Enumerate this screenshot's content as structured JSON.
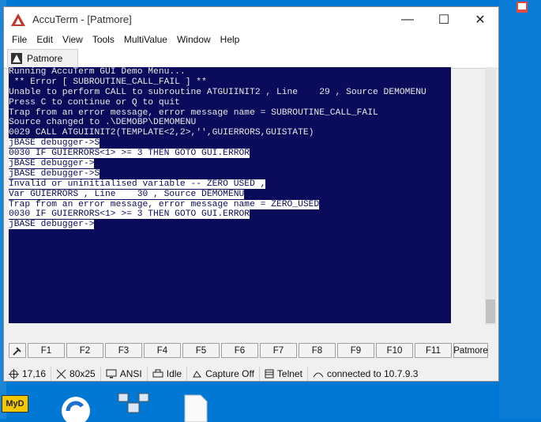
{
  "window": {
    "title": "AccuTerm - [Patmore]",
    "controls": {
      "minimize": "—",
      "maximize": "☐",
      "close": "✕"
    }
  },
  "menu": [
    "File",
    "Edit",
    "View",
    "Tools",
    "MultiValue",
    "Window",
    "Help"
  ],
  "tab": {
    "label": "Patmore"
  },
  "terminal": {
    "background": "#0b0b5c",
    "lines": [
      {
        "text": "Running AccuTerm GUI Demo Menu...",
        "hl": false
      },
      {
        "text": " ** Error [ SUBROUTINE_CALL_FAIL ] **",
        "hl": false
      },
      {
        "text": "Unable to perform CALL to subroutine ATGUIINIT2 , Line    29 , Source DEMOMENU",
        "hl": false
      },
      {
        "text": "Press C to continue or Q to quit",
        "hl": false
      },
      {
        "text": "Trap from an error message, error message name = SUBROUTINE_CALL_FAIL",
        "hl": false
      },
      {
        "text": "Source changed to .\\DEMOBP\\DEMOMENU",
        "hl": false
      },
      {
        "text": "0029 CALL ATGUIINIT2(TEMPLATE<2,2>,'',GUIERRORS,GUISTATE)",
        "hl": false
      },
      {
        "text": "jBASE debugger->S",
        "hl": true
      },
      {
        "text": "0030 IF GUIERRORS<1> >= 3 THEN GOTO GUI.ERROR",
        "hl": true
      },
      {
        "text": "jBASE debugger->",
        "hl": true
      },
      {
        "text": "jBASE debugger->S",
        "hl": true
      },
      {
        "text": "Invalid or uninitialised variable -- ZERO USED ,",
        "hl": true
      },
      {
        "text": "Var GUIERRORS , Line    30 , Source DEMOMENU",
        "hl": true
      },
      {
        "text": "Trap from an error message, error message name = ZERO_USED",
        "hl": true
      },
      {
        "text": "0030 IF GUIERRORS<1> >= 3 THEN GOTO GUI.ERROR",
        "hl": true
      },
      {
        "text": "jBASE debugger->",
        "hl": true
      }
    ]
  },
  "function_keys": [
    "F1",
    "F2",
    "F3",
    "F4",
    "F5",
    "F6",
    "F7",
    "F8",
    "F9",
    "F10",
    "F11",
    "Patmore"
  ],
  "status": {
    "cursor": "17,16",
    "size": "80x25",
    "emulation": "ANSI",
    "printer": "Idle",
    "capture": "Capture Off",
    "protocol": "Telnet",
    "connection": "connected to 10.7.9.3"
  },
  "desktop": {
    "myd_label": "MyD"
  }
}
